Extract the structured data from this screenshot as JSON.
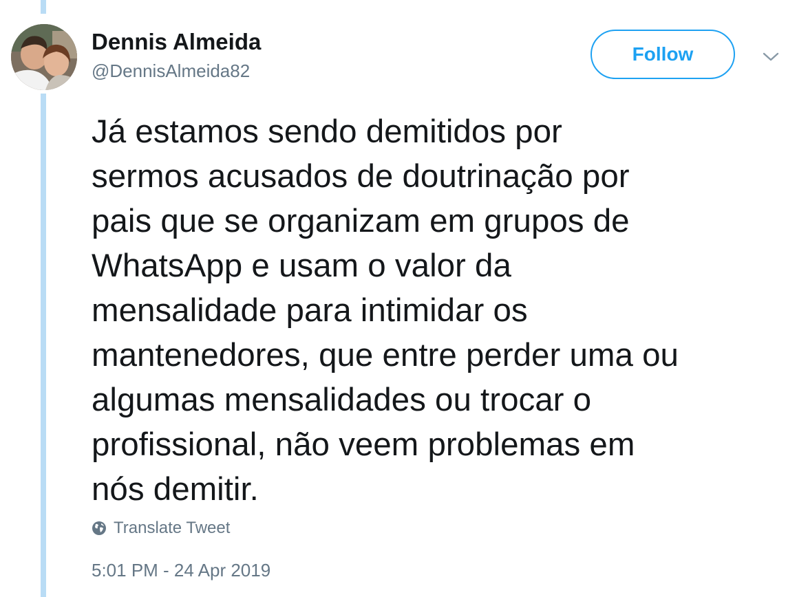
{
  "author": {
    "display_name": "Dennis Almeida",
    "handle": "@DennisAlmeida82",
    "avatar_icon": "profile-photo"
  },
  "actions": {
    "follow_label": "Follow",
    "menu_icon": "chevron-down-icon"
  },
  "tweet": {
    "lines": [
      "Já estamos sendo demitidos por",
      "sermos acusados de doutrinação por",
      "pais que se organizam em grupos de",
      "WhatsApp e usam o valor da",
      "mensalidade para intimidar os",
      "mantenedores, que entre perder uma ou",
      "algumas mensalidades ou trocar o",
      "profissional, não veem problemas em",
      "nós demitir."
    ],
    "translate_label": "Translate Tweet",
    "timestamp": "5:01 PM - 24 Apr 2019"
  },
  "colors": {
    "accent": "#1da1f2",
    "thread_line": "#b9dcf5",
    "text_primary": "#14171a",
    "text_secondary": "#657786"
  }
}
